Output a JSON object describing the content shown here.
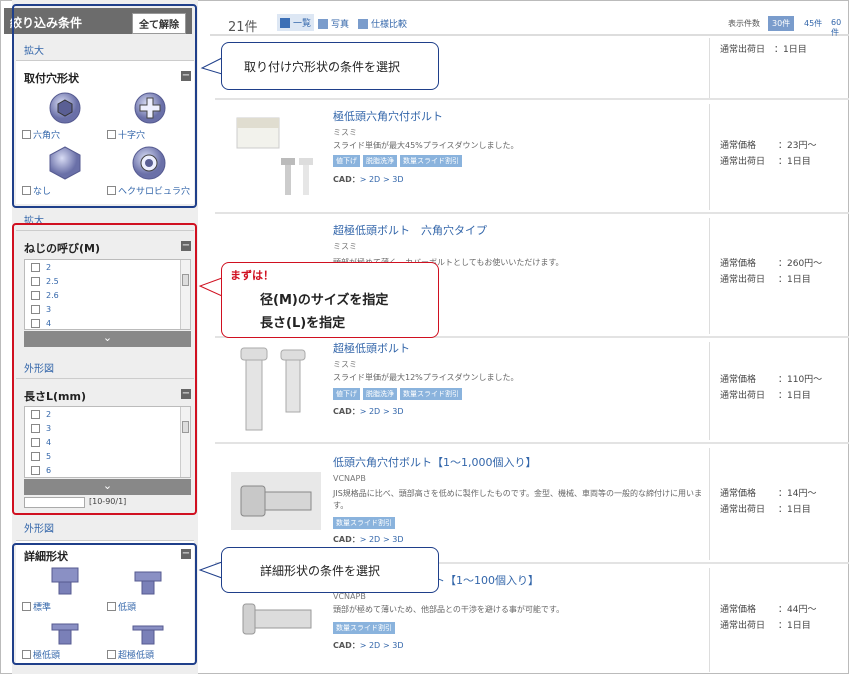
{
  "sidebar": {
    "header_title": "絞り込み条件",
    "clear_all": "全て解除",
    "expand1": "拡大",
    "hole_shape": {
      "title": "取付穴形状",
      "options": [
        "六角穴",
        "十字穴",
        "なし",
        "ヘクサロビュラ穴"
      ]
    },
    "expand2": "拡大",
    "thread": {
      "title": "ねじの呼び(M)",
      "items": [
        "2",
        "2.5",
        "2.6",
        "3",
        "4"
      ]
    },
    "outline1": "外形図",
    "length": {
      "title": "長さL(mm)",
      "items": [
        "2",
        "3",
        "4",
        "5",
        "6"
      ],
      "range_hint": "[10-90/1]"
    },
    "outline2": "外形図",
    "detail": {
      "title": "詳細形状",
      "options": [
        "標準",
        "低頭",
        "極低頭",
        "超極低頭"
      ]
    }
  },
  "toolbar": {
    "count": "21件",
    "views": [
      "一覧",
      "写真",
      "仕様比較"
    ],
    "per_page_label": "表示件数",
    "per_page_options": [
      "30件",
      "45件",
      "60件"
    ]
  },
  "top_row_ship": "通常出荷日　：1日目",
  "products": [
    {
      "name": "極低頭六角穴付ボルト",
      "maker": "ミスミ",
      "desc": "スライド単価が最大45%プライスダウンしました。",
      "tags": [
        "値下げ",
        "脱脂洗浄",
        "数量スライド割引"
      ],
      "cad_label": "CAD：",
      "cad": [
        "> 2D",
        "> 3D"
      ],
      "price_label": "通常価格",
      "price": "：23円〜",
      "ship_label": "通常出荷日",
      "ship": "：1日目"
    },
    {
      "name": "超極低頭ボルト　六角穴タイプ",
      "maker": "ミスミ",
      "desc": "頭部が極めて薄く、カバーボルトとしてもお使いいただけます。",
      "tags": [],
      "cad_label": "",
      "cad": [],
      "price_label": "通常価格",
      "price": "：260円〜",
      "ship_label": "通常出荷日",
      "ship": "：1日目"
    },
    {
      "name": "超極低頭ボルト",
      "maker": "ミスミ",
      "desc": "スライド単価が最大12%プライスダウンしました。",
      "tags": [
        "値下げ",
        "脱脂洗浄",
        "数量スライド割引"
      ],
      "cad_label": "CAD：",
      "cad": [
        "> 2D",
        "> 3D"
      ],
      "price_label": "通常価格",
      "price": "：110円〜",
      "ship_label": "通常出荷日",
      "ship": "：1日目"
    },
    {
      "name": "低頭六角穴付ボルト【1〜1,000個入り】",
      "maker": "VCNAPB",
      "desc": "JIS規格品に比べ、頭部高さを低めに製作したものです。金型、機械、車両等の一般的な締付けに用います。",
      "tags": [
        "数量スライド割引"
      ],
      "cad_label": "CAD：",
      "cad": [
        "> 2D",
        "> 3D"
      ],
      "price_label": "通常価格",
      "price": "：14円〜",
      "ship_label": "通常出荷日",
      "ship": "：1日目"
    },
    {
      "name": "ルト【1〜100個入り】",
      "maker": "VCNAPB",
      "desc": "頭部が極めて薄いため、他部品との干渉を避ける事が可能です。",
      "tags": [
        "数量スライド割引"
      ],
      "cad_label": "CAD：",
      "cad": [
        "> 2D",
        "> 3D"
      ],
      "price_label": "通常価格",
      "price": "：44円〜",
      "ship_label": "通常出荷日",
      "ship": "：1日目"
    }
  ],
  "callouts": {
    "c1": "取り付け穴形状の条件を選択",
    "c2_head": "まずは！",
    "c2_line1": "径(M)のサイズを指定",
    "c2_line2": "長さ(L)を指定",
    "c3": "詳細形状の条件を選択"
  },
  "colors": {
    "accent_blue": "#1f3f8a",
    "highlight_red": "#d01020",
    "link": "#3366aa"
  }
}
